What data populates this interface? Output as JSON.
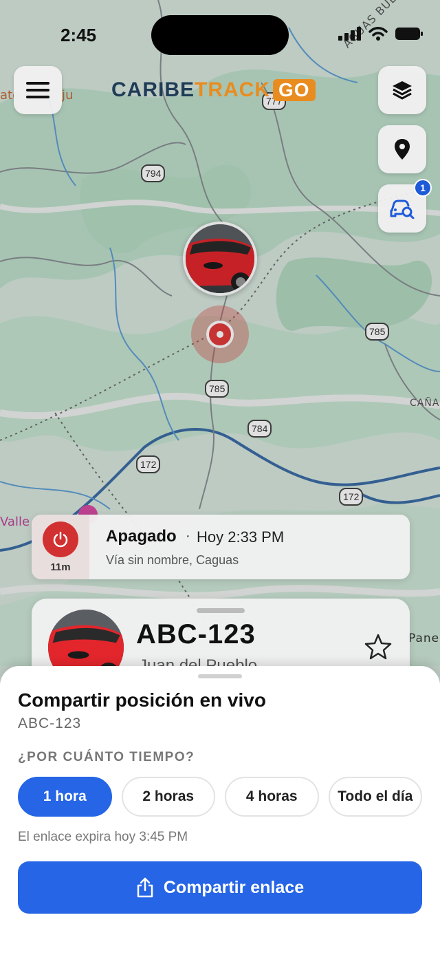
{
  "status_bar": {
    "time": "2:45"
  },
  "header": {
    "logo_main": "CARIBE",
    "logo_track": "TRACK",
    "logo_go": "GO",
    "notification_count": "1"
  },
  "map": {
    "shields": [
      "777",
      "794",
      "785",
      "785",
      "784",
      "172",
      "172"
    ],
    "labels": [
      "AGUAS BUENAS",
      "CAÑA",
      "Panes",
      "Valle",
      "ate",
      "ju"
    ]
  },
  "event": {
    "status": "Apagado",
    "separator": "·",
    "time": "Hoy 2:33 PM",
    "address": "Vía sin nombre, Caguas",
    "duration": "11m"
  },
  "vehicle": {
    "plate": "ABC-123",
    "owner": "Juan del Pueblo"
  },
  "sheet": {
    "title": "Compartir posición en vivo",
    "subtitle": "ABC-123",
    "duration_label": "¿POR CUÁNTO TIEMPO?",
    "options": [
      "1 hora",
      "2 horas",
      "4 horas",
      "Todo el día"
    ],
    "selected_index": 0,
    "expiry": "El enlace expira hoy 3:45 PM",
    "share_label": "Compartir enlace"
  },
  "colors": {
    "accent": "#2565e6",
    "power_off": "#d23131",
    "brand_orange": "#e98c1f",
    "brand_navy": "#1f3c57"
  }
}
